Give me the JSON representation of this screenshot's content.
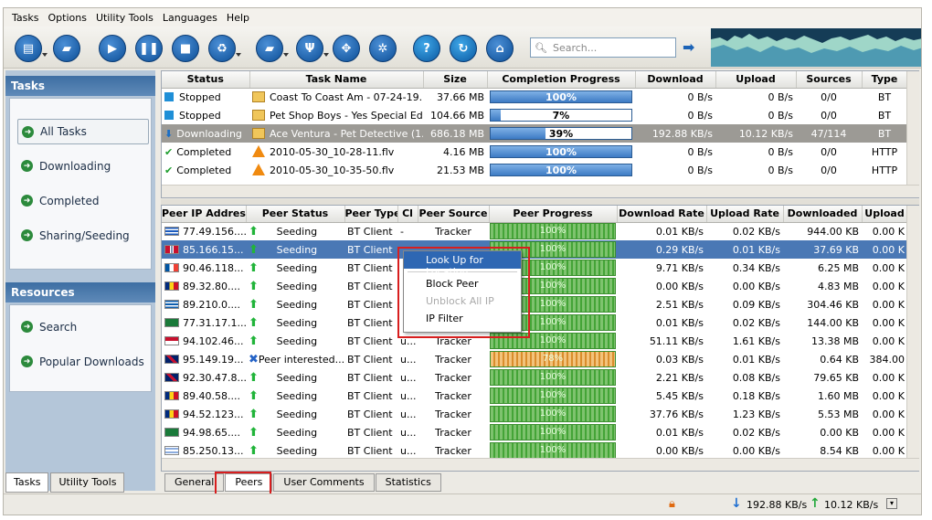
{
  "menu": [
    "Tasks",
    "Options",
    "Utility Tools",
    "Languages",
    "Help"
  ],
  "search": {
    "placeholder": "Search..."
  },
  "sidebar": {
    "tasks_title": "Tasks",
    "task_items": [
      {
        "label": "All Tasks"
      },
      {
        "label": "Downloading"
      },
      {
        "label": "Completed"
      },
      {
        "label": "Sharing/Seeding"
      }
    ],
    "resources_title": "Resources",
    "resource_items": [
      {
        "label": "Search"
      },
      {
        "label": "Popular Downloads"
      }
    ],
    "tabs": [
      "Tasks",
      "Utility Tools"
    ]
  },
  "tasks": {
    "columns": [
      "Status",
      "Task Name",
      "Size",
      "Completion Progress",
      "Download",
      "Upload",
      "Sources",
      "Type"
    ],
    "rows": [
      {
        "status": "Stopped",
        "name": "Coast To Coast Am - 07-24-19...",
        "size": "37.66 MB",
        "progress": "100%",
        "pct": 100,
        "download": "0 B/s",
        "upload": "0 B/s",
        "sources": "0/0",
        "type": "BT"
      },
      {
        "status": "Stopped",
        "name": "Pet Shop Boys - Yes Special Edi...",
        "size": "104.66 MB",
        "progress": "7%",
        "pct": 7,
        "download": "0 B/s",
        "upload": "0 B/s",
        "sources": "0/0",
        "type": "BT"
      },
      {
        "status": "Downloading",
        "name": "Ace Ventura - Pet Detective (1...",
        "size": "686.18 MB",
        "progress": "39%",
        "pct": 39,
        "download": "192.88 KB/s",
        "upload": "10.12 KB/s",
        "sources": "47/114",
        "type": "BT"
      },
      {
        "status": "Completed",
        "name": "2010-05-30_10-28-11.flv",
        "size": "4.16 MB",
        "progress": "100%",
        "pct": 100,
        "download": "0 B/s",
        "upload": "0 B/s",
        "sources": "0/0",
        "type": "HTTP"
      },
      {
        "status": "Completed",
        "name": "2010-05-30_10-35-50.flv",
        "size": "21.53 MB",
        "progress": "100%",
        "pct": 100,
        "download": "0 B/s",
        "upload": "0 B/s",
        "sources": "0/0",
        "type": "HTTP"
      }
    ]
  },
  "peers": {
    "columns": [
      "Peer IP Address",
      "Peer Status",
      "Peer Type",
      "Cl",
      "Peer Source",
      "Peer Progress",
      "Download Rate",
      "Upload Rate",
      "Downloaded",
      "Upload"
    ],
    "rows": [
      {
        "ip": "77.49.156....",
        "status": "Seeding",
        "type": "BT Client",
        "cl": "-",
        "source": "Tracker",
        "progress": "100%",
        "down": "0.01 KB/s",
        "up": "0.02 KB/s",
        "downloaded": "944.00 KB",
        "upl": "0.00 K"
      },
      {
        "ip": "85.166.15...",
        "status": "Seeding",
        "type": "BT Client",
        "cl": "",
        "source": "",
        "progress": "100%",
        "down": "0.29 KB/s",
        "up": "0.01 KB/s",
        "downloaded": "37.69 KB",
        "upl": "0.00 K"
      },
      {
        "ip": "90.46.118...",
        "status": "Seeding",
        "type": "BT Client",
        "cl": "",
        "source": "",
        "progress": "100%",
        "down": "9.71 KB/s",
        "up": "0.34 KB/s",
        "downloaded": "6.25 MB",
        "upl": "0.00 K"
      },
      {
        "ip": "89.32.80....",
        "status": "Seeding",
        "type": "BT Client",
        "cl": "",
        "source": "",
        "progress": "100%",
        "down": "0.00 KB/s",
        "up": "0.00 KB/s",
        "downloaded": "4.83 MB",
        "upl": "0.00 K"
      },
      {
        "ip": "89.210.0....",
        "status": "Seeding",
        "type": "BT Client",
        "cl": "",
        "source": "",
        "progress": "100%",
        "down": "2.51 KB/s",
        "up": "0.09 KB/s",
        "downloaded": "304.46 KB",
        "upl": "0.00 K"
      },
      {
        "ip": "77.31.17.1...",
        "status": "Seeding",
        "type": "BT Client",
        "cl": "",
        "source": "",
        "progress": "100%",
        "down": "0.01 KB/s",
        "up": "0.02 KB/s",
        "downloaded": "144.00 KB",
        "upl": "0.00 K"
      },
      {
        "ip": "94.102.46...",
        "status": "Seeding",
        "type": "BT Client",
        "cl": "u...",
        "source": "Tracker",
        "progress": "100%",
        "down": "51.11 KB/s",
        "up": "1.61 KB/s",
        "downloaded": "13.38 MB",
        "upl": "0.00 K"
      },
      {
        "ip": "95.149.19...",
        "status": "Peer interested...",
        "type": "BT Client",
        "cl": "u...",
        "source": "Tracker",
        "progress": "78%",
        "down": "0.03 KB/s",
        "up": "0.01 KB/s",
        "downloaded": "0.64 KB",
        "upl": "384.00"
      },
      {
        "ip": "92.30.47.8...",
        "status": "Seeding",
        "type": "BT Client",
        "cl": "u...",
        "source": "Tracker",
        "progress": "100%",
        "down": "2.21 KB/s",
        "up": "0.08 KB/s",
        "downloaded": "79.65 KB",
        "upl": "0.00 K"
      },
      {
        "ip": "89.40.58....",
        "status": "Seeding",
        "type": "BT Client",
        "cl": "u...",
        "source": "Tracker",
        "progress": "100%",
        "down": "5.45 KB/s",
        "up": "0.18 KB/s",
        "downloaded": "1.60 MB",
        "upl": "0.00 K"
      },
      {
        "ip": "94.52.123...",
        "status": "Seeding",
        "type": "BT Client",
        "cl": "u...",
        "source": "Tracker",
        "progress": "100%",
        "down": "37.76 KB/s",
        "up": "1.23 KB/s",
        "downloaded": "5.53 MB",
        "upl": "0.00 K"
      },
      {
        "ip": "94.98.65....",
        "status": "Seeding",
        "type": "BT Client",
        "cl": "u...",
        "source": "Tracker",
        "progress": "100%",
        "down": "0.01 KB/s",
        "up": "0.02 KB/s",
        "downloaded": "0.00 KB",
        "upl": "0.00 K"
      },
      {
        "ip": "85.250.13...",
        "status": "Seeding",
        "type": "BT Client",
        "cl": "u...",
        "source": "Tracker",
        "progress": "100%",
        "down": "0.00 KB/s",
        "up": "0.00 KB/s",
        "downloaded": "8.54 KB",
        "upl": "0.00 K"
      }
    ]
  },
  "context_menu": {
    "items": [
      "Look Up for Location",
      "Block Peer",
      "Unblock All IP",
      "IP Filter"
    ]
  },
  "bottom_tabs": [
    "General",
    "Peers",
    "User Comments",
    "Statistics"
  ],
  "status": {
    "download_speed": "192.88 KB/s",
    "upload_speed": "10.12 KB/s"
  }
}
